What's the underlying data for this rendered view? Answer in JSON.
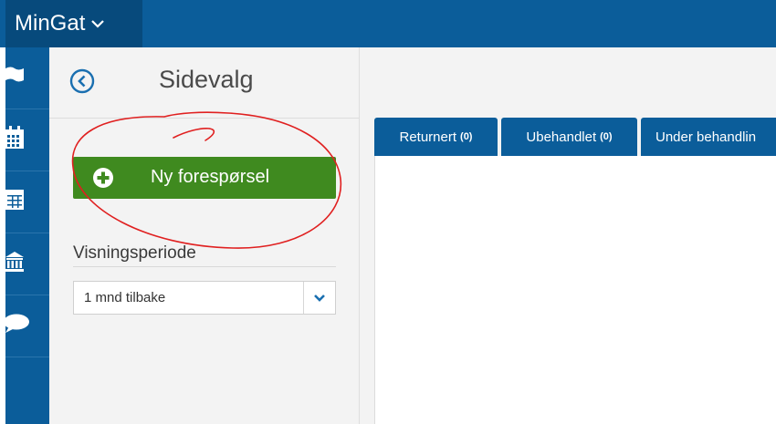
{
  "app": {
    "title": "MinGat",
    "brand_color": "#0b5d9a",
    "brand_dark": "#074a7c"
  },
  "rail": {
    "items": [
      {
        "icon": "flag-icon"
      },
      {
        "icon": "calendar-icon"
      },
      {
        "icon": "table-icon"
      },
      {
        "icon": "bank-icon"
      },
      {
        "icon": "chat-bubble-icon"
      }
    ]
  },
  "panel": {
    "title": "Sidevalg",
    "new_request_label": "Ny forespørsel",
    "new_request_color": "#3f8a1f",
    "period_label": "Visningsperiode",
    "period_selected": "1 mnd tilbake"
  },
  "tabs": [
    {
      "label": "Returnert",
      "count": "(0)"
    },
    {
      "label": "Ubehandlet",
      "count": "(0)"
    },
    {
      "label": "Under behandlin",
      "count": ""
    }
  ],
  "annotation": {
    "color": "#e02020",
    "shape": "hand-drawn-circle"
  }
}
